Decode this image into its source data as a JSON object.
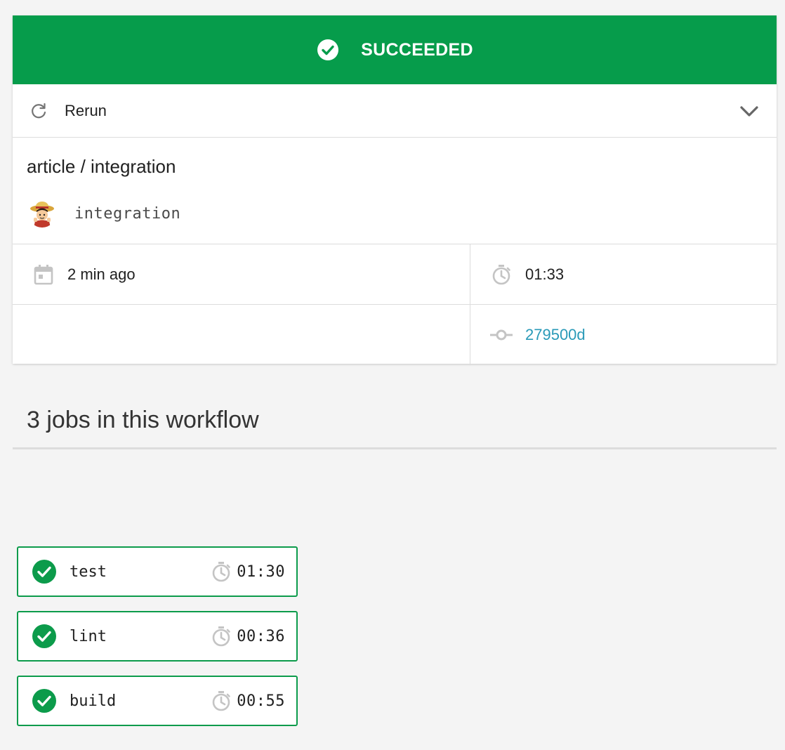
{
  "colors": {
    "success_green": "#069c4b",
    "link_blue": "#2a9ab8",
    "background": "#f4f4f4"
  },
  "status": {
    "label": "SUCCEEDED",
    "icon": "check-circle-icon"
  },
  "actions": {
    "rerun_label": "Rerun",
    "rerun_icon": "refresh-icon",
    "expand_icon": "chevron-down-icon"
  },
  "workflow": {
    "repo_path": "article / integration",
    "branch": "integration",
    "avatar_icon": "user-avatar"
  },
  "meta": {
    "started": "2 min ago",
    "started_icon": "calendar-icon",
    "duration": "01:33",
    "duration_icon": "stopwatch-icon",
    "commit": "279500d",
    "commit_icon": "commit-icon"
  },
  "jobs_section": {
    "heading": "3 jobs in this workflow"
  },
  "jobs": [
    {
      "name": "test",
      "duration": "01:30",
      "status": "success"
    },
    {
      "name": "lint",
      "duration": "00:36",
      "status": "success"
    },
    {
      "name": "build",
      "duration": "00:55",
      "status": "success"
    }
  ]
}
